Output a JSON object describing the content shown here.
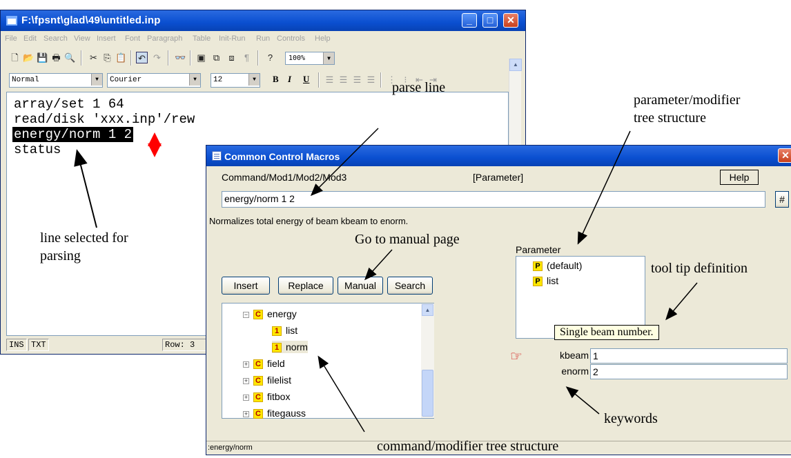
{
  "editor": {
    "title": "F:\\fpsnt\\glad\\49\\untitled.inp",
    "menu": [
      "File",
      "Edit",
      "Search",
      "View",
      "Insert",
      "Font",
      "Paragraph",
      "Table",
      "Init-Run",
      "Run",
      "Controls",
      "Help"
    ],
    "zoom": "100%",
    "style_combo": "Normal",
    "font_combo": "Courier",
    "size_combo": "12",
    "format_buttons": [
      "B",
      "I",
      "U"
    ],
    "lines": [
      "array/set 1 64",
      "read/disk 'xxx.inp'/rew",
      "energy/norm 1 2",
      "status"
    ],
    "selected_line_index": 2,
    "status": {
      "ins": "INS",
      "txt": "TXT",
      "row": "Row: 3"
    }
  },
  "dialog": {
    "title": "Common Control Macros",
    "command_label": "Command/Mod1/Mod2/Mod3",
    "parameter_label": "[Parameter]",
    "help_button": "Help",
    "hash_button": "#",
    "command_value": "energy/norm 1 2",
    "description": "Normalizes total energy of beam kbeam to enorm.",
    "buttons": {
      "insert": "Insert",
      "replace": "Replace",
      "manual": "Manual",
      "search": "Search"
    },
    "command_tree": [
      {
        "glyph": "C",
        "label": "energy",
        "expanded": true
      },
      {
        "glyph": "1",
        "label": "list"
      },
      {
        "glyph": "1",
        "label": "norm"
      },
      {
        "glyph": "C",
        "label": "field"
      },
      {
        "glyph": "C",
        "label": "filelist"
      },
      {
        "glyph": "C",
        "label": "fitbox"
      },
      {
        "glyph": "C",
        "label": "fitegauss"
      }
    ],
    "parameter_heading": "Parameter",
    "parameter_tree": [
      {
        "glyph": "P",
        "label": "(default)"
      },
      {
        "glyph": "P",
        "label": "list"
      }
    ],
    "tooltip": "Single beam number.",
    "keywords": [
      {
        "name": "kbeam",
        "value": "1"
      },
      {
        "name": "enorm",
        "value": "2"
      }
    ],
    "status_text": ":energy/norm"
  },
  "annotations": {
    "parse_line": "parse line",
    "param_tree_1": "parameter/modifier",
    "param_tree_2": "tree structure",
    "line_selected_1": "line selected for",
    "line_selected_2": "parsing",
    "manual_page": "Go to manual page",
    "tooltip_def": "tool tip definition",
    "keywords": "keywords",
    "cmd_tree": "command/modifier tree structure"
  },
  "colors": {
    "titlebar": "#0a4fd0",
    "window_bg": "#ece9d8",
    "selection": "#000000",
    "marker": "#ff0000",
    "tree_glyph": "#ffe700"
  }
}
